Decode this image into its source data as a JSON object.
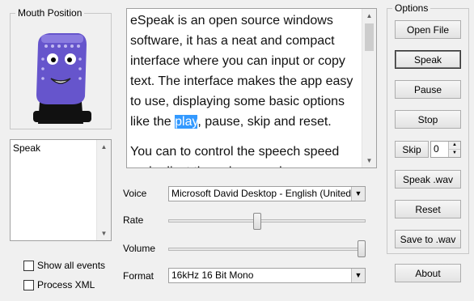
{
  "mouth": {
    "title": "Mouth Position"
  },
  "log": {
    "value": "Speak"
  },
  "options": {
    "title": "Options",
    "open_file": "Open File",
    "speak": "Speak",
    "pause": "Pause",
    "stop": "Stop",
    "skip": "Skip",
    "skip_value": "0",
    "speak_wav": "Speak .wav",
    "reset": "Reset",
    "save_to_wav": "Save to .wav",
    "about": "About"
  },
  "text_editor": {
    "para1_before": "eSpeak is an open source windows software, it has a neat and compact interface where you can input or copy text. The interface makes the app easy to use, displaying some basic options like the ",
    "para1_highlight": "play",
    "para1_after": ", pause, skip and reset.",
    "para2": "You can to control the speech speed and adjust the volume and"
  },
  "controls": {
    "voice_label": "Voice",
    "voice_value": "Microsoft David Desktop - English (United St",
    "rate_label": "Rate",
    "rate_level": 0.45,
    "volume_label": "Volume",
    "volume_level": 1.0,
    "format_label": "Format",
    "format_value": "16kHz 16 Bit Mono"
  },
  "checkboxes": {
    "show_all_events": "Show all events",
    "show_all_events_checked": false,
    "process_xml": "Process XML",
    "process_xml_checked": false
  },
  "colors": {
    "highlight": "#3399ff",
    "face": "#6655cc",
    "window": "#f0f0f0"
  }
}
